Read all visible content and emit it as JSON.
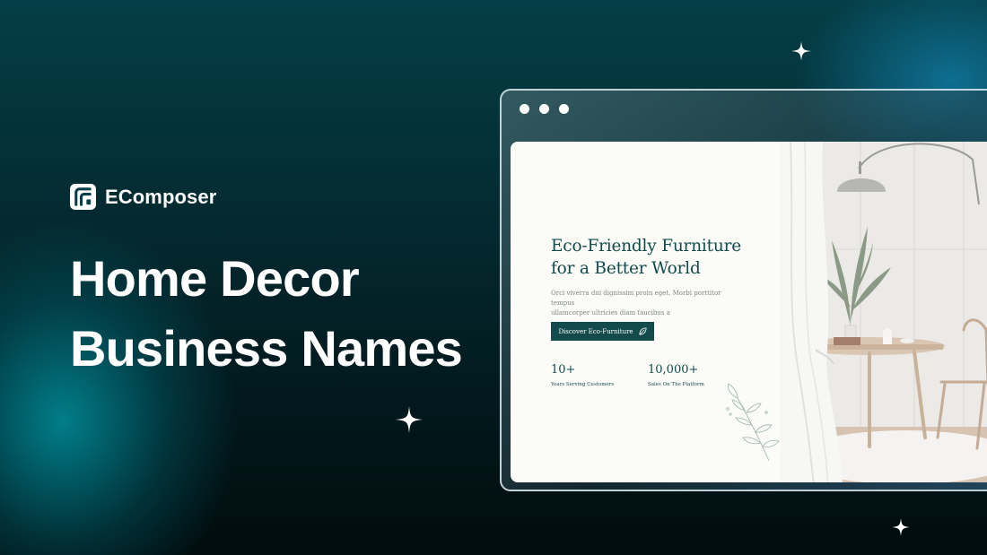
{
  "brand": {
    "name": "EComposer",
    "logo_icon": "ecomposer-logo-icon"
  },
  "headline": {
    "line1": "Home Decor",
    "line2": "Business Names"
  },
  "browser": {
    "window_controls": [
      "dot",
      "dot",
      "dot"
    ],
    "page": {
      "title_line1": "Eco-Friendly Furniture",
      "title_line2": "for a Better World",
      "description_line1": "Orci viverra dui dignissim proin eget. Morbi porttitor tempus",
      "description_line2": "ullamcorper ultricies diam faucibus a",
      "cta_label": "Discover Eco-Furniture",
      "cta_icon": "leaf-icon",
      "stats": [
        {
          "value": "10+",
          "label": "Years Serving Customers"
        },
        {
          "value": "10,000+",
          "label": "Sales On The Platform"
        }
      ],
      "image": "living-room-photo"
    }
  },
  "colors": {
    "accent": "#134a4b",
    "background_dark": "#021a1e",
    "glow": "#00a0af"
  }
}
